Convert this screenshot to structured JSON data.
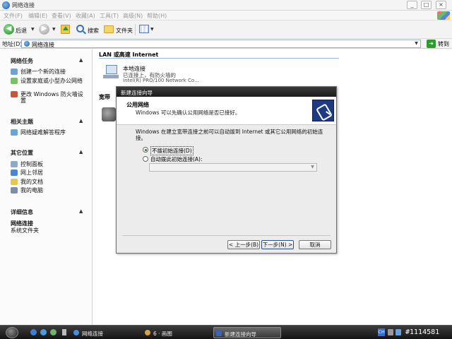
{
  "window": {
    "title": "网络连接"
  },
  "menu": [
    "文件(F)",
    "编辑(E)",
    "查看(V)",
    "收藏(A)",
    "工具(T)",
    "高级(N)",
    "帮助(H)"
  ],
  "toolbar": {
    "back_label": "后退",
    "search_label": "搜索",
    "folders_label": "文件夹"
  },
  "address": {
    "label": "地址(D)",
    "value": "网络连接",
    "go_label": "转到"
  },
  "sidebar": {
    "network_tasks": {
      "title": "网络任务",
      "items": [
        "创建一个新的连接",
        "设置家庭或小型办公网络",
        "更改 Windows 防火墙设置"
      ]
    },
    "see_also": {
      "title": "相关主题",
      "items": [
        "网络疑难解答程序"
      ]
    },
    "other_places": {
      "title": "其它位置",
      "items": [
        "控制面板",
        "网上邻居",
        "我的文档",
        "我的电脑"
      ]
    },
    "details": {
      "title": "详细信息",
      "name": "网络连接",
      "type": "系统文件夹"
    }
  },
  "main": {
    "group_lan": "LAN 或高速 Internet",
    "connection": {
      "name": "本地连接",
      "status": "已连接上，有防火墙的",
      "device": "Intel(R) PRO/100 Network Co..."
    },
    "group_broadband": "宽带"
  },
  "dialog": {
    "title": "新建连接向导",
    "header_title": "公用网络",
    "header_subtitle": "Windows 可以先确认公用网络是否已接好。",
    "description": "Windows 在建立宽带连接之前可以自动拨到 Internet 或其它公用网络的初始连接。",
    "option_no_dial": "不拨初始连接(D)",
    "option_auto_dial": "自动拨此初始连接(A):",
    "back_button": "< 上一步(B)",
    "next_button": "下一步(N) >",
    "cancel_button": "取消"
  },
  "taskbar": {
    "items": [
      "网络连接",
      "6 · 画图",
      "新建连接向导"
    ],
    "tray_lang": "CH",
    "watermark": "#1114581"
  }
}
